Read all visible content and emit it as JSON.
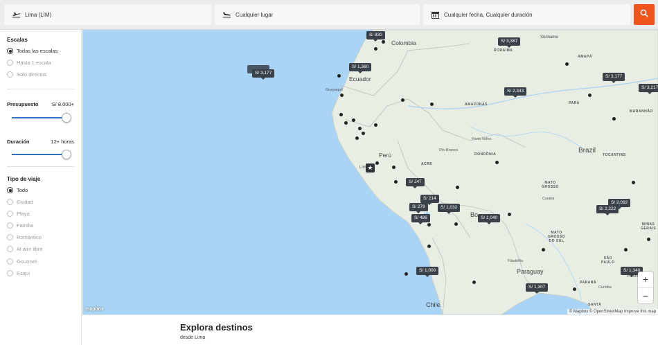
{
  "search": {
    "origin": "Lima (LIM)",
    "destination": "Cualquier lugar",
    "dates": "Cualquier fecha, Cualquier duración"
  },
  "sidebar": {
    "escalas": {
      "title": "Escalas",
      "options": [
        "Todas las escalas",
        "Hasta 1 escala",
        "Solo directos"
      ],
      "selected": 0
    },
    "presupuesto": {
      "label": "Presupuesto",
      "value": "S/ 8,000+"
    },
    "duracion": {
      "label": "Duración",
      "value": "12+ horas"
    },
    "tipo": {
      "title": "Tipo de viaje",
      "options": [
        "Todo",
        "Ciudad",
        "Playa",
        "Familia",
        "Romántico",
        "Al aire libre",
        "Gourmet",
        "Esquí"
      ],
      "selected": 0
    }
  },
  "map": {
    "prices": [
      "S/ 830",
      "S/ 3,387",
      "S/ 1,360",
      "S/ 3,177",
      "S/ 2,343",
      "S/ 3,177",
      "S/ 3,217",
      "S/ 247",
      "S/ 214",
      "S/ 279",
      "S/ 1,032",
      "S/ 486",
      "S/ 1,040",
      "S/ 2,092",
      "S/ 2,222",
      "S/ 1,000",
      "S/ 1,340",
      "S/ 1,307"
    ],
    "countries": [
      "Colombia",
      "Ecuador",
      "Perú",
      "Brazil",
      "Paraguay",
      "Chile",
      "Bo",
      "Suriname"
    ],
    "regions": [
      "RORAIMA",
      "AMAPÁ",
      "AMAZONAS",
      "PARÁ",
      "MARANHÃO",
      "ACRE",
      "RONDÔNIA",
      "TOCANTINS",
      "MATO\nGROSSO",
      "MATO\nGROSSO\nDO SUL",
      "MINAS\nGERAIS",
      "SÃO\nPAULO",
      "PARANÁ",
      "SANTA"
    ],
    "cities": [
      "Guayaquil",
      "Porto Velho",
      "Rio Branco",
      "Cuiabá",
      "Curitiba",
      "Lim",
      "Paraná",
      "Filadelfia"
    ],
    "attribution": "© Mapbox © OpenStreetMap Improve this map",
    "logo": "mapbox",
    "zoom_in": "+",
    "zoom_out": "−"
  },
  "bottom": {
    "title": "Explora destinos",
    "subtitle": "desde Lima"
  },
  "colors": {
    "accent": "#f0541d",
    "water": "#a9d4f5",
    "land": "#e9eee4",
    "slider": "#2e6fbf"
  }
}
